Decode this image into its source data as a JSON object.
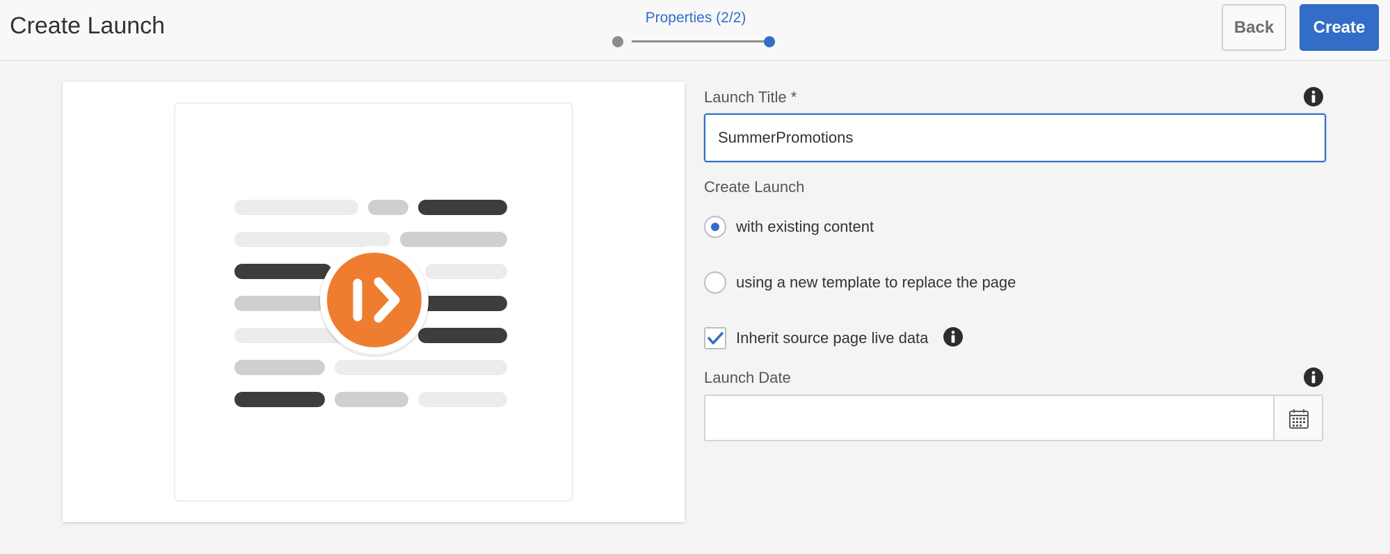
{
  "header": {
    "title": "Create Launch",
    "step_label": "Properties (2/2)",
    "back_label": "Back",
    "create_label": "Create"
  },
  "preview": {
    "icon": "launch-play-icon",
    "accent_color": "#ef7d30"
  },
  "form": {
    "title_label": "Launch Title *",
    "title_value": "SummerPromotions",
    "create_launch_label": "Create Launch",
    "options": [
      {
        "label": "with existing content",
        "selected": true
      },
      {
        "label": "using a new template to replace the page",
        "selected": false
      }
    ],
    "inherit_label": "Inherit source page live data",
    "inherit_checked": true,
    "launch_date_label": "Launch Date",
    "launch_date_value": ""
  },
  "colors": {
    "primary": "#326ec8",
    "background": "#f4f4f4"
  }
}
